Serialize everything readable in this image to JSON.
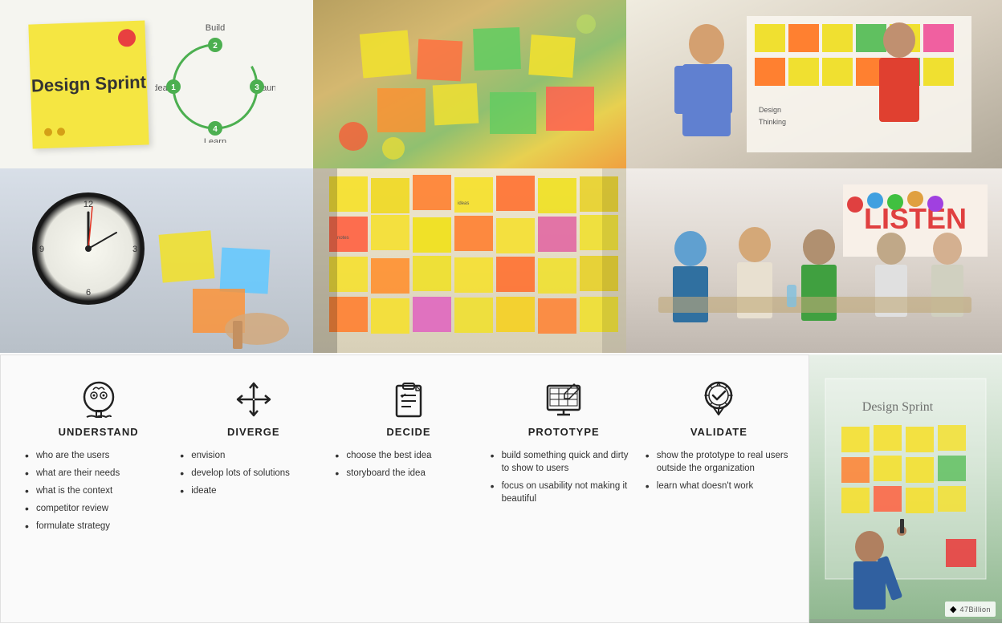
{
  "header": {
    "title": "Design Sprint"
  },
  "cycle": {
    "labels": [
      "Idea",
      "Build",
      "Launch",
      "Learn"
    ],
    "numbers": [
      "1",
      "2",
      "3",
      "4"
    ]
  },
  "stages": [
    {
      "id": "understand",
      "title": "UNDERSTAND",
      "icon": "head-icon",
      "items": [
        "who are the users",
        "what are their needs",
        "what is the context",
        "competitor review",
        "formulate strategy"
      ]
    },
    {
      "id": "diverge",
      "title": "DIVERGE",
      "icon": "arrows-icon",
      "items": [
        "envision",
        "develop lots of solutions",
        "ideate"
      ]
    },
    {
      "id": "decide",
      "title": "DECIDE",
      "icon": "checklist-icon",
      "items": [
        "choose the best idea",
        "storyboard the idea"
      ]
    },
    {
      "id": "prototype",
      "title": "PROTOTYPE",
      "icon": "screen-icon",
      "items": [
        "build something quick and dirty to show to users",
        "focus on usability not making it beautiful"
      ]
    },
    {
      "id": "validate",
      "title": "VALIDATE",
      "icon": "badge-icon",
      "items": [
        "show the prototype to real users outside the organization",
        "learn what doesn't work"
      ]
    }
  ],
  "footer": {
    "brand": "47Billion"
  }
}
